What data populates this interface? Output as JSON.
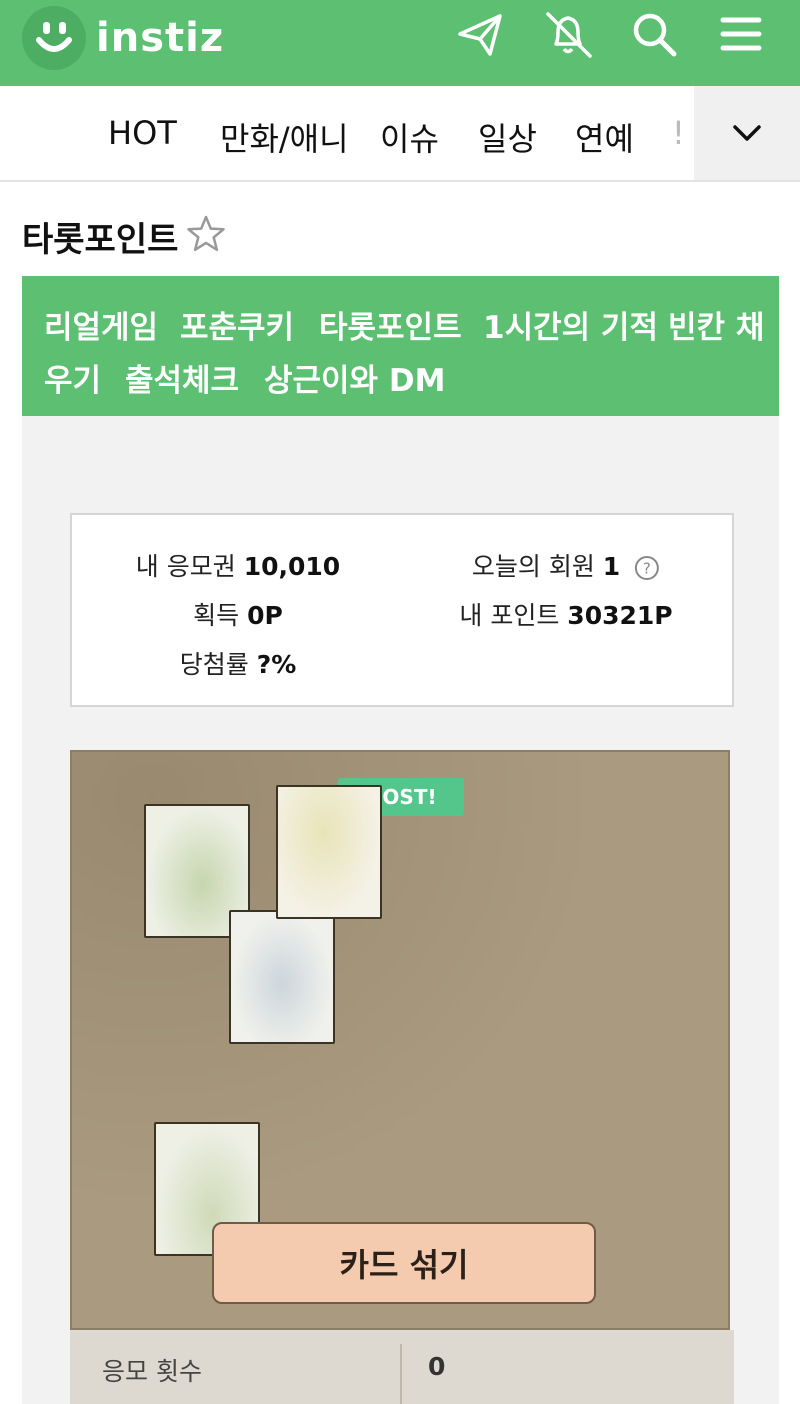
{
  "app": {
    "logo_text": "instiz"
  },
  "header_icons": [
    {
      "name": "paper-plane-icon"
    },
    {
      "name": "bell-off-icon"
    },
    {
      "name": "search-icon"
    },
    {
      "name": "menu-icon"
    }
  ],
  "categories": {
    "items": [
      "HOT",
      "만화/애니",
      "이슈",
      "일상",
      "연예",
      "!"
    ]
  },
  "board": {
    "title": "타롯포인트"
  },
  "game_nav": {
    "items": [
      "리얼게임",
      "포춘쿠키",
      "타롯포인트",
      "1시간의 기적",
      "빈칸 채",
      "우기",
      "출석체크",
      "상근이와 DM"
    ]
  },
  "stats": {
    "tickets_label": "내 응모권",
    "tickets_value": "10,010",
    "members_label": "오늘의 회원",
    "members_value": "1",
    "earned_label": "획득",
    "earned_value": "0P",
    "points_label": "내 포인트",
    "points_value": "30321P",
    "rate_label": "당첨률",
    "rate_value": "?%"
  },
  "game": {
    "boost_label": "OOST!",
    "shuffle_button": "카드 섞기"
  },
  "entry": {
    "label": "응모 횟수",
    "value": "0"
  },
  "colors": {
    "brand_green": "#5cbf72",
    "table": "#aa9b80",
    "button": "#f5cbaf",
    "boost": "#54c58b"
  }
}
